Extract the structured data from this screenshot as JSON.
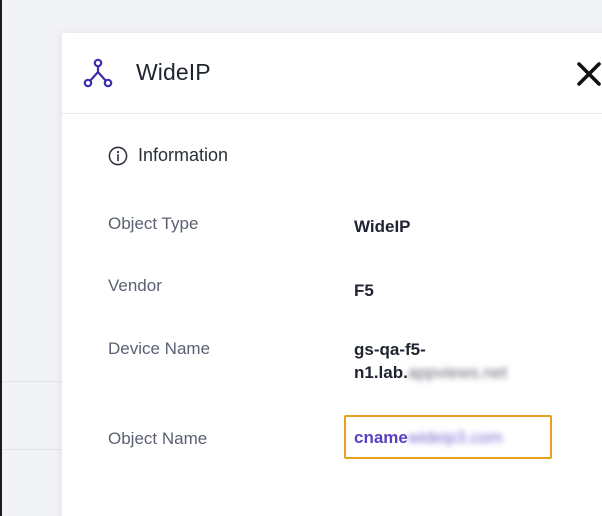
{
  "panel": {
    "title": "WideIP",
    "icon": "network-topology-icon",
    "close_icon": "close-icon"
  },
  "section": {
    "title": "Information",
    "icon": "info-icon"
  },
  "fields": [
    {
      "label": "Object Type",
      "value": "WideIP"
    },
    {
      "label": "Vendor",
      "value": "F5"
    },
    {
      "label": "Device Name",
      "value_line1": "gs-qa-f5-",
      "value_line2": "n1.lab.",
      "value_redacted": "appviews.net"
    },
    {
      "label": "Object Name",
      "value_prefix": "cname",
      "value_redacted": "wideip3.com"
    }
  ],
  "colors": {
    "link": "#5a3fc4",
    "highlight_border": "#e6a21a",
    "icon": "#3b2db0"
  }
}
